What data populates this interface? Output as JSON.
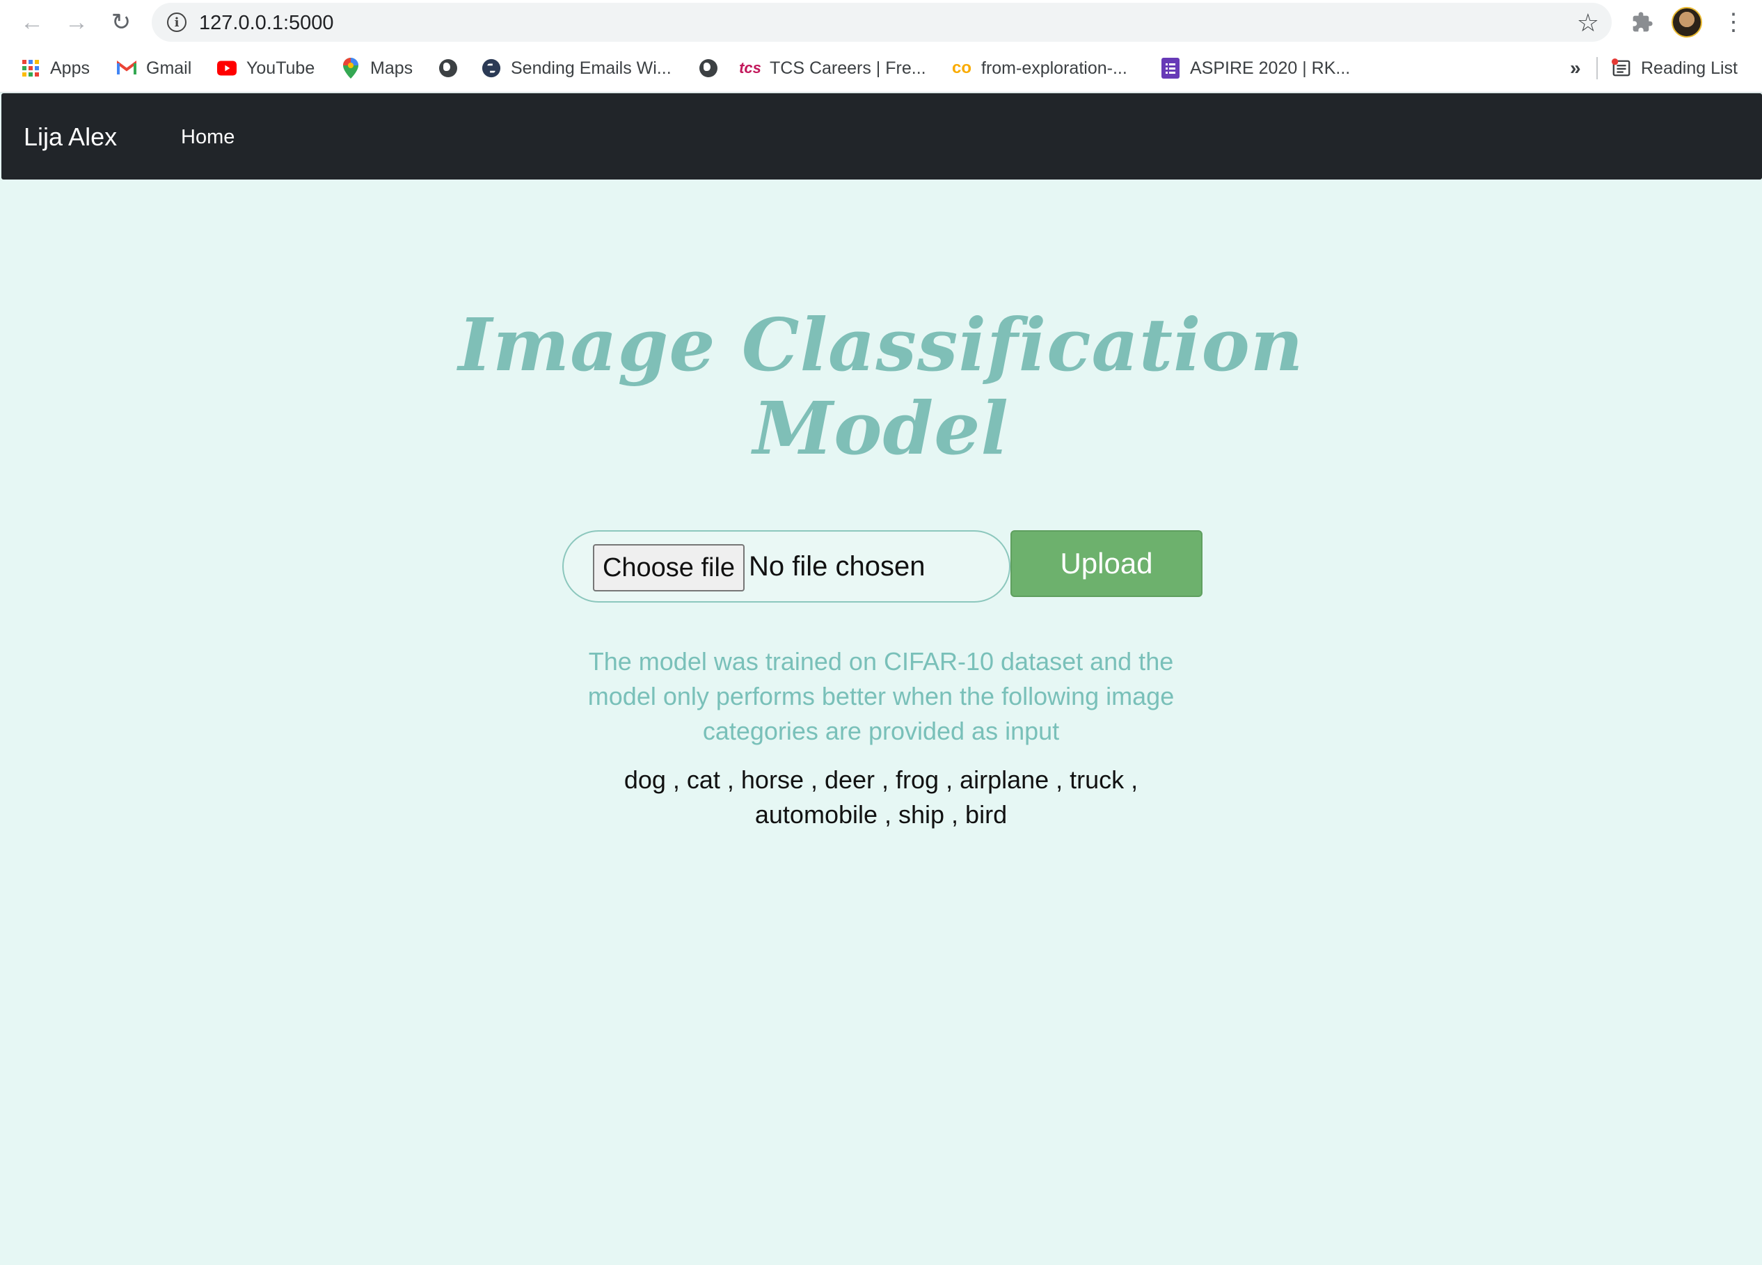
{
  "browser": {
    "url": "127.0.0.1:5000",
    "nav": {
      "back_icon": "arrow-left-icon",
      "forward_icon": "arrow-right-icon",
      "reload_icon": "reload-icon"
    },
    "bookmarks": [
      {
        "label": "Apps",
        "icon": "apps-grid-icon"
      },
      {
        "label": "Gmail",
        "icon": "gmail-icon"
      },
      {
        "label": "YouTube",
        "icon": "youtube-icon"
      },
      {
        "label": "Maps",
        "icon": "maps-pin-icon"
      },
      {
        "label": "",
        "icon": "globe-icon"
      },
      {
        "label": "Sending Emails Wi...",
        "icon": "python-icon"
      },
      {
        "label": "",
        "icon": "globe-icon"
      },
      {
        "label": "TCS Careers | Fre...",
        "icon": "tcs-icon"
      },
      {
        "label": "from-exploration-...",
        "icon": "colab-icon"
      },
      {
        "label": "ASPIRE 2020 | RK...",
        "icon": "forms-icon"
      }
    ],
    "overflow": "»",
    "reading_list": "Reading List"
  },
  "site": {
    "brand": "Lija Alex",
    "nav_home": "Home"
  },
  "main": {
    "title_line1": "Image Classification",
    "title_line2": "Model",
    "file_button": "Choose file",
    "file_status": "No file chosen",
    "upload_label": "Upload",
    "description": "The model was trained on CIFAR-10 dataset and the model only performs better when the following image categories are provided as input",
    "categories_line1": "dog , cat , horse , deer , frog , airplane , truck ,",
    "categories_line2": "automobile , ship , bird"
  },
  "colors": {
    "navbar": "#212529",
    "page_bg": "#e6f7f4",
    "accent_teal": "#7fbfb7",
    "upload_green": "#6db16d"
  }
}
